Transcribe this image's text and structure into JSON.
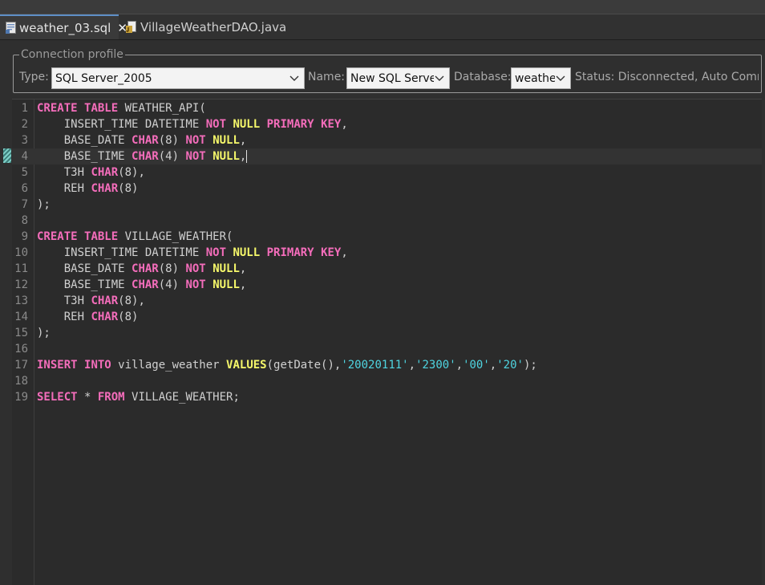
{
  "tabs": [
    {
      "label": "weather_03.sql",
      "close": "✕",
      "icon": "sql-file-icon",
      "active": true
    },
    {
      "label": "VillageWeatherDAO.java",
      "icon": "java-file-icon",
      "active": false
    }
  ],
  "connection": {
    "legend": "Connection profile",
    "type_label": "Type:",
    "type_value": "SQL Server_2005",
    "name_label": "Name:",
    "name_value": "New SQL Serve",
    "database_label": "Database:",
    "database_value": "weathe",
    "status": "Status: Disconnected, Auto Comm"
  },
  "editor": {
    "current_line": 4,
    "line_numbers": [
      "1",
      "2",
      "3",
      "4",
      "5",
      "6",
      "7",
      "8",
      "9",
      "10",
      "11",
      "12",
      "13",
      "14",
      "15",
      "16",
      "17",
      "18",
      "19"
    ],
    "lines": [
      [
        [
          "kw",
          "CREATE"
        ],
        [
          "t",
          " "
        ],
        [
          "kw",
          "TABLE"
        ],
        [
          "t",
          " WEATHER_API("
        ]
      ],
      [
        [
          "t",
          "    INSERT_TIME DATETIME "
        ],
        [
          "kw",
          "NOT"
        ],
        [
          "t",
          " "
        ],
        [
          "lit",
          "NULL"
        ],
        [
          "t",
          " "
        ],
        [
          "kw",
          "PRIMARY"
        ],
        [
          "t",
          " "
        ],
        [
          "kw",
          "KEY"
        ],
        [
          "t",
          ","
        ]
      ],
      [
        [
          "t",
          "    BASE_DATE "
        ],
        [
          "kw",
          "CHAR"
        ],
        [
          "t",
          "(8) "
        ],
        [
          "kw",
          "NOT"
        ],
        [
          "t",
          " "
        ],
        [
          "lit",
          "NULL"
        ],
        [
          "t",
          ","
        ]
      ],
      [
        [
          "t",
          "    BASE_TIME "
        ],
        [
          "kw",
          "CHAR"
        ],
        [
          "t",
          "(4) "
        ],
        [
          "kw",
          "NOT"
        ],
        [
          "t",
          " "
        ],
        [
          "lit",
          "NULL"
        ],
        [
          "t",
          ","
        ]
      ],
      [
        [
          "t",
          "    T3H "
        ],
        [
          "kw",
          "CHAR"
        ],
        [
          "t",
          "(8),"
        ]
      ],
      [
        [
          "t",
          "    REH "
        ],
        [
          "kw",
          "CHAR"
        ],
        [
          "t",
          "(8)"
        ]
      ],
      [
        [
          "t",
          ");"
        ]
      ],
      [],
      [
        [
          "kw",
          "CREATE"
        ],
        [
          "t",
          " "
        ],
        [
          "kw",
          "TABLE"
        ],
        [
          "t",
          " VILLAGE_WEATHER("
        ]
      ],
      [
        [
          "t",
          "    INSERT_TIME DATETIME "
        ],
        [
          "kw",
          "NOT"
        ],
        [
          "t",
          " "
        ],
        [
          "lit",
          "NULL"
        ],
        [
          "t",
          " "
        ],
        [
          "kw",
          "PRIMARY"
        ],
        [
          "t",
          " "
        ],
        [
          "kw",
          "KEY"
        ],
        [
          "t",
          ","
        ]
      ],
      [
        [
          "t",
          "    BASE_DATE "
        ],
        [
          "kw",
          "CHAR"
        ],
        [
          "t",
          "(8) "
        ],
        [
          "kw",
          "NOT"
        ],
        [
          "t",
          " "
        ],
        [
          "lit",
          "NULL"
        ],
        [
          "t",
          ","
        ]
      ],
      [
        [
          "t",
          "    BASE_TIME "
        ],
        [
          "kw",
          "CHAR"
        ],
        [
          "t",
          "(4) "
        ],
        [
          "kw",
          "NOT"
        ],
        [
          "t",
          " "
        ],
        [
          "lit",
          "NULL"
        ],
        [
          "t",
          ","
        ]
      ],
      [
        [
          "t",
          "    T3H "
        ],
        [
          "kw",
          "CHAR"
        ],
        [
          "t",
          "(8),"
        ]
      ],
      [
        [
          "t",
          "    REH "
        ],
        [
          "kw",
          "CHAR"
        ],
        [
          "t",
          "(8)"
        ]
      ],
      [
        [
          "t",
          ");"
        ]
      ],
      [],
      [
        [
          "kw",
          "INSERT"
        ],
        [
          "t",
          " "
        ],
        [
          "kw",
          "INTO"
        ],
        [
          "t",
          " village_weather "
        ],
        [
          "lit",
          "VALUES"
        ],
        [
          "t",
          "(getDate(),"
        ],
        [
          "str",
          "'20020111'"
        ],
        [
          "t",
          ","
        ],
        [
          "str",
          "'2300'"
        ],
        [
          "t",
          ","
        ],
        [
          "str",
          "'00'"
        ],
        [
          "t",
          ","
        ],
        [
          "str",
          "'20'"
        ],
        [
          "t",
          ");"
        ]
      ],
      [],
      [
        [
          "kw",
          "SELECT"
        ],
        [
          "t",
          " * "
        ],
        [
          "kw",
          "FROM"
        ],
        [
          "t",
          " VILLAGE_WEATHER;"
        ]
      ]
    ]
  }
}
